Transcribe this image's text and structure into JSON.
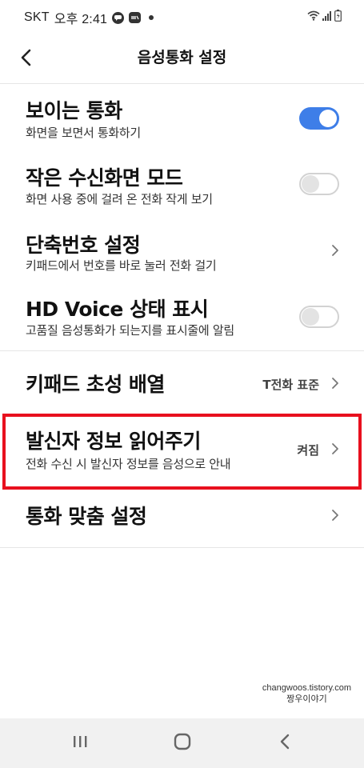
{
  "status_bar": {
    "carrier": "SKT",
    "time": "오후 2:41",
    "notification_icons": [
      "talk-bubble-icon",
      "app-icon"
    ],
    "right_icons": [
      "wifi-icon",
      "signal-icon",
      "battery-icon"
    ]
  },
  "header": {
    "title": "음성통화 설정",
    "back_icon": "back-arrow-icon"
  },
  "settings": {
    "video_call": {
      "title": "보이는 통화",
      "subtitle": "화면을 보면서 통화하기",
      "toggle": "on"
    },
    "small_screen": {
      "title": "작은 수신화면 모드",
      "subtitle": "화면 사용 중에 걸려 온 전화 작게 보기",
      "toggle": "off"
    },
    "speed_dial": {
      "title": "단축번호 설정",
      "subtitle": "키패드에서 번호를 바로 눌러 전화 걸기"
    },
    "hd_voice": {
      "title": "HD Voice 상태 표시",
      "subtitle": "고품질 음성통화가 되는지를 표시줄에 알림",
      "toggle": "off"
    },
    "keypad_initial": {
      "title": "키패드 초성 배열",
      "value": "T전화 표준"
    },
    "caller_info": {
      "title": "발신자 정보 읽어주기",
      "subtitle": "전화 수신 시 발신자 정보를 음성으로 안내",
      "value": "켜짐"
    },
    "call_custom": {
      "title": "통화 맞춤 설정"
    }
  },
  "watermark": {
    "line1": "changwoos.tistory.com",
    "line2": "짱우이야기"
  },
  "colors": {
    "toggle_on": "#3e7ee8",
    "highlight_border": "#e8101e"
  },
  "nav_bar": {
    "icons": [
      "recent-apps-icon",
      "home-icon",
      "back-icon"
    ]
  }
}
